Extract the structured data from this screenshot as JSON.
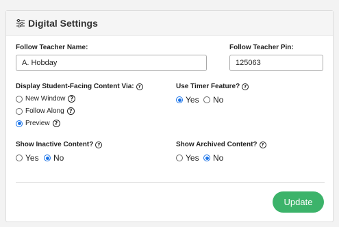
{
  "panel": {
    "title": "Digital Settings",
    "icon": "sliders-icon"
  },
  "teacher_name": {
    "label": "Follow Teacher Name:",
    "value": "A. Hobday"
  },
  "teacher_pin": {
    "label": "Follow Teacher Pin:",
    "value": "125063"
  },
  "display_via": {
    "label": "Display Student-Facing Content Via:",
    "options": [
      {
        "label": "New Window",
        "checked": false
      },
      {
        "label": "Follow Along",
        "checked": false
      },
      {
        "label": "Preview",
        "checked": true
      }
    ]
  },
  "timer": {
    "label": "Use Timer Feature?",
    "yes": "Yes",
    "no": "No",
    "selected": "Yes"
  },
  "inactive": {
    "label": "Show Inactive Content?",
    "yes": "Yes",
    "no": "No",
    "selected": "No"
  },
  "archived": {
    "label": "Show Archived Content?",
    "yes": "Yes",
    "no": "No",
    "selected": "No"
  },
  "actions": {
    "update_label": "Update"
  },
  "colors": {
    "accent": "#1a73e8",
    "update_button": "#3cb36a"
  }
}
